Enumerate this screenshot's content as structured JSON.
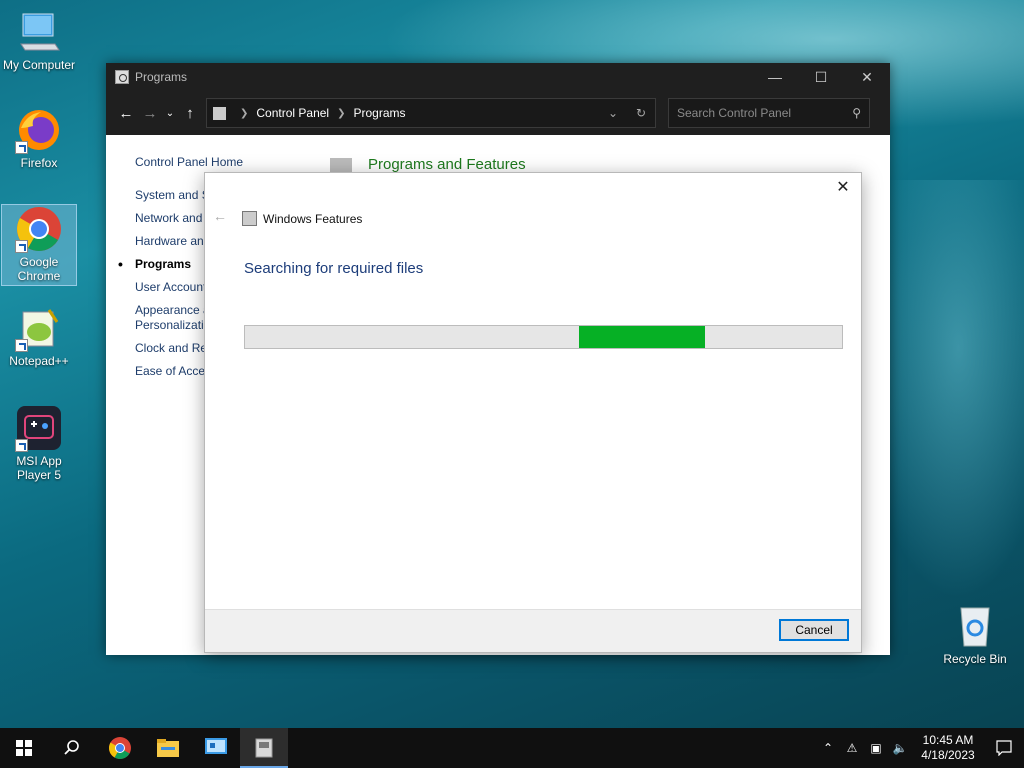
{
  "desktop": {
    "icons": [
      {
        "label": "My Computer"
      },
      {
        "label": "Firefox"
      },
      {
        "label": "Google Chrome"
      },
      {
        "label": "Notepad++"
      },
      {
        "label": "MSI App Player 5"
      },
      {
        "label": "Recycle Bin"
      }
    ]
  },
  "explorer": {
    "title": "Programs",
    "breadcrumb": [
      "Control Panel",
      "Programs"
    ],
    "search_placeholder": "Search Control Panel",
    "leftnav": [
      "Control Panel Home",
      "System and Security",
      "Network and Internet",
      "Hardware and Sound",
      "Programs",
      "User Accounts",
      "Appearance and",
      "Personalization",
      "Clock and Region",
      "Ease of Access"
    ],
    "main_link": "Programs and Features"
  },
  "dialog": {
    "title": "Windows Features",
    "heading": "Searching for required files",
    "progress": {
      "start": 0.56,
      "end": 0.77,
      "color": "#06b025"
    },
    "cancel_label": "Cancel"
  },
  "taskbar": {
    "time": "10:45 AM",
    "date": "4/18/2023"
  }
}
